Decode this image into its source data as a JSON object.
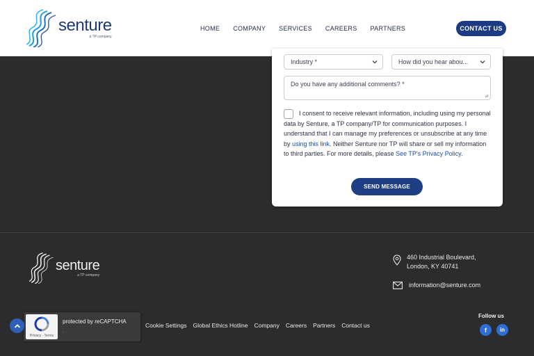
{
  "header": {
    "logo_word": "senture",
    "logo_tag": "a TP company",
    "nav": [
      "HOME",
      "COMPANY",
      "SERVICES",
      "CAREERS",
      "PARTNERS"
    ],
    "contact_label": "CONTACT US"
  },
  "form": {
    "industry_placeholder": "Industry *",
    "source_placeholder": "How did you hear abou...",
    "comments_placeholder": "Do you have any additional comments? *",
    "consent_part1": "I consent to receive relevant information, including using my personal data by Senture, a TP company/TP for communication purposes. I understand that I can manage my preferences or unsubscribe at any time by ",
    "consent_link1": "using this link",
    "consent_part2": ". Neither Senture nor TP will share or sell my information to third parties. For more details, please ",
    "consent_link2": "See TP's Privacy Policy",
    "consent_part3": ".",
    "send_label": "SEND MESSAGE"
  },
  "footer": {
    "logo_word": "senture",
    "logo_tag": "a TP company",
    "address_line1": "460 Industrial Boulevard,",
    "address_line2": "London, KY 40741",
    "email": "information@senture.com",
    "recaptcha_text": "protected by reCAPTCHA",
    "recaptcha_dot": ".",
    "recaptcha_links": "Privacy - Terms",
    "links": [
      "Cookie Settings",
      "Global Ethics Hotline",
      "Company",
      "Careers",
      "Partners",
      "Contact us"
    ],
    "follow_label": "Follow us",
    "facebook_glyph": "f",
    "linkedin_glyph": "in"
  },
  "colors": {
    "brand_navy": "#1d3a84",
    "footer_bg": "#2c2c2e",
    "link_blue": "#1d4fa8",
    "social_blue": "#2f6ed4"
  }
}
